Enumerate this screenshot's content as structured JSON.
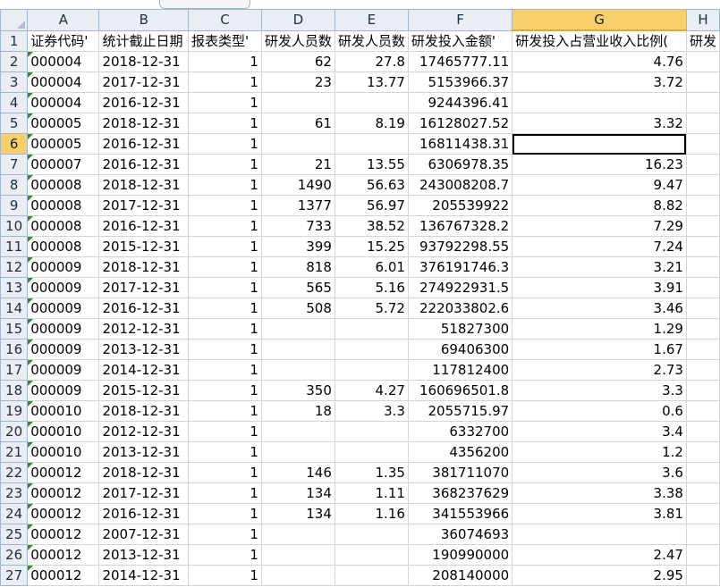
{
  "columns": [
    {
      "letter": "A",
      "header": "证券代码'"
    },
    {
      "letter": "B",
      "header": "统计截止日期"
    },
    {
      "letter": "C",
      "header": "报表类型'"
    },
    {
      "letter": "D",
      "header": "研发人员数"
    },
    {
      "letter": "E",
      "header": "研发人员数"
    },
    {
      "letter": "F",
      "header": "研发投入金额'"
    },
    {
      "letter": "G",
      "header": "研发投入占营业收入比例("
    },
    {
      "letter": "H",
      "header": "研发"
    }
  ],
  "selected_column": "G",
  "selected_row": "6",
  "rows": [
    {
      "n": "2",
      "a": "000004",
      "b": "2018-12-31",
      "c": "1",
      "d": "62",
      "e": "27.8",
      "f": "17465777.11",
      "g": "4.76"
    },
    {
      "n": "3",
      "a": "000004",
      "b": "2017-12-31",
      "c": "1",
      "d": "23",
      "e": "13.77",
      "f": "5153966.37",
      "g": "3.72"
    },
    {
      "n": "4",
      "a": "000004",
      "b": "2016-12-31",
      "c": "1",
      "d": "",
      "e": "",
      "f": "9244396.41",
      "g": ""
    },
    {
      "n": "5",
      "a": "000005",
      "b": "2018-12-31",
      "c": "1",
      "d": "61",
      "e": "8.19",
      "f": "16128027.52",
      "g": "3.32"
    },
    {
      "n": "6",
      "a": "000005",
      "b": "2016-12-31",
      "c": "1",
      "d": "",
      "e": "",
      "f": "16811438.31",
      "g": ""
    },
    {
      "n": "7",
      "a": "000007",
      "b": "2016-12-31",
      "c": "1",
      "d": "21",
      "e": "13.55",
      "f": "6306978.35",
      "g": "16.23"
    },
    {
      "n": "8",
      "a": "000008",
      "b": "2018-12-31",
      "c": "1",
      "d": "1490",
      "e": "56.63",
      "f": "243008208.7",
      "g": "9.47"
    },
    {
      "n": "9",
      "a": "000008",
      "b": "2017-12-31",
      "c": "1",
      "d": "1377",
      "e": "56.97",
      "f": "205539922",
      "g": "8.82"
    },
    {
      "n": "10",
      "a": "000008",
      "b": "2016-12-31",
      "c": "1",
      "d": "733",
      "e": "38.52",
      "f": "136767328.2",
      "g": "7.29"
    },
    {
      "n": "11",
      "a": "000008",
      "b": "2015-12-31",
      "c": "1",
      "d": "399",
      "e": "15.25",
      "f": "93792298.55",
      "g": "7.24"
    },
    {
      "n": "12",
      "a": "000009",
      "b": "2018-12-31",
      "c": "1",
      "d": "818",
      "e": "6.01",
      "f": "376191746.3",
      "g": "3.21"
    },
    {
      "n": "13",
      "a": "000009",
      "b": "2017-12-31",
      "c": "1",
      "d": "565",
      "e": "5.16",
      "f": "274922931.5",
      "g": "3.91"
    },
    {
      "n": "14",
      "a": "000009",
      "b": "2016-12-31",
      "c": "1",
      "d": "508",
      "e": "5.72",
      "f": "222033802.6",
      "g": "3.46"
    },
    {
      "n": "15",
      "a": "000009",
      "b": "2012-12-31",
      "c": "1",
      "d": "",
      "e": "",
      "f": "51827300",
      "g": "1.29"
    },
    {
      "n": "16",
      "a": "000009",
      "b": "2013-12-31",
      "c": "1",
      "d": "",
      "e": "",
      "f": "69406300",
      "g": "1.67"
    },
    {
      "n": "17",
      "a": "000009",
      "b": "2014-12-31",
      "c": "1",
      "d": "",
      "e": "",
      "f": "117812400",
      "g": "2.73"
    },
    {
      "n": "18",
      "a": "000009",
      "b": "2015-12-31",
      "c": "1",
      "d": "350",
      "e": "4.27",
      "f": "160696501.8",
      "g": "3.3"
    },
    {
      "n": "19",
      "a": "000010",
      "b": "2018-12-31",
      "c": "1",
      "d": "18",
      "e": "3.3",
      "f": "2055715.97",
      "g": "0.6"
    },
    {
      "n": "20",
      "a": "000010",
      "b": "2012-12-31",
      "c": "1",
      "d": "",
      "e": "",
      "f": "6332700",
      "g": "3.4"
    },
    {
      "n": "21",
      "a": "000010",
      "b": "2013-12-31",
      "c": "1",
      "d": "",
      "e": "",
      "f": "4356200",
      "g": "1.2"
    },
    {
      "n": "22",
      "a": "000012",
      "b": "2018-12-31",
      "c": "1",
      "d": "146",
      "e": "1.35",
      "f": "381711070",
      "g": "3.6"
    },
    {
      "n": "23",
      "a": "000012",
      "b": "2017-12-31",
      "c": "1",
      "d": "134",
      "e": "1.11",
      "f": "368237629",
      "g": "3.38"
    },
    {
      "n": "24",
      "a": "000012",
      "b": "2016-12-31",
      "c": "1",
      "d": "134",
      "e": "1.16",
      "f": "341553966",
      "g": "3.81"
    },
    {
      "n": "25",
      "a": "000012",
      "b": "2007-12-31",
      "c": "1",
      "d": "",
      "e": "",
      "f": "36074693",
      "g": ""
    },
    {
      "n": "26",
      "a": "000012",
      "b": "2013-12-31",
      "c": "1",
      "d": "",
      "e": "",
      "f": "190990000",
      "g": "2.47"
    },
    {
      "n": "27",
      "a": "000012",
      "b": "2014-12-31",
      "c": "1",
      "d": "",
      "e": "",
      "f": "208140000",
      "g": "2.95"
    }
  ]
}
